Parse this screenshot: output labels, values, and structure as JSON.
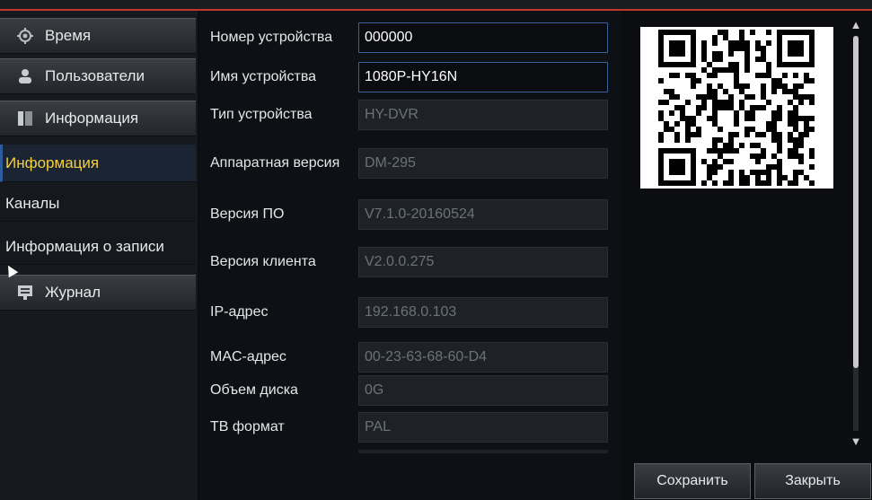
{
  "sidebar": {
    "items": [
      {
        "label": "Время",
        "icon": "gear-icon",
        "type": "main"
      },
      {
        "label": "Пользователи",
        "icon": "user-icon",
        "type": "main"
      },
      {
        "label": "Информация",
        "icon": "info-icon",
        "type": "main"
      },
      {
        "label": "Информация",
        "type": "sub",
        "active": true
      },
      {
        "label": "Каналы",
        "type": "sub"
      },
      {
        "label": "Информация о записи",
        "type": "sub"
      },
      {
        "label": "Журнал",
        "icon": "log-icon",
        "type": "main"
      }
    ]
  },
  "form": {
    "fields": [
      {
        "label": "Номер устройства",
        "value": "000000",
        "editable": true
      },
      {
        "label": "Имя устройства",
        "value": "1080P-HY16N",
        "editable": true
      },
      {
        "label": "Тип устройства",
        "value": "HY-DVR",
        "editable": false
      },
      {
        "label": "Аппаратная версия",
        "value": "DM-295",
        "editable": false
      },
      {
        "label": "Версия ПО",
        "value": "V7.1.0-20160524",
        "editable": false
      },
      {
        "label": "Версия клиента",
        "value": "V2.0.0.275",
        "editable": false
      },
      {
        "label": "IP-адрес",
        "value": "192.168.0.103",
        "editable": false
      },
      {
        "label": "MAC-адрес",
        "value": "00-23-63-68-60-D4",
        "editable": false
      },
      {
        "label": "Объем диска",
        "value": "0G",
        "editable": false
      },
      {
        "label": "ТВ формат",
        "value": "PAL",
        "editable": false
      }
    ]
  },
  "buttons": {
    "save": "Сохранить",
    "close": "Закрыть"
  },
  "colors": {
    "accent": "#f4d03f",
    "active_bg": "#1b2433",
    "field_border": "#3b5f9a"
  },
  "icons": {
    "scroll_up": "▲",
    "scroll_down": "▼"
  }
}
